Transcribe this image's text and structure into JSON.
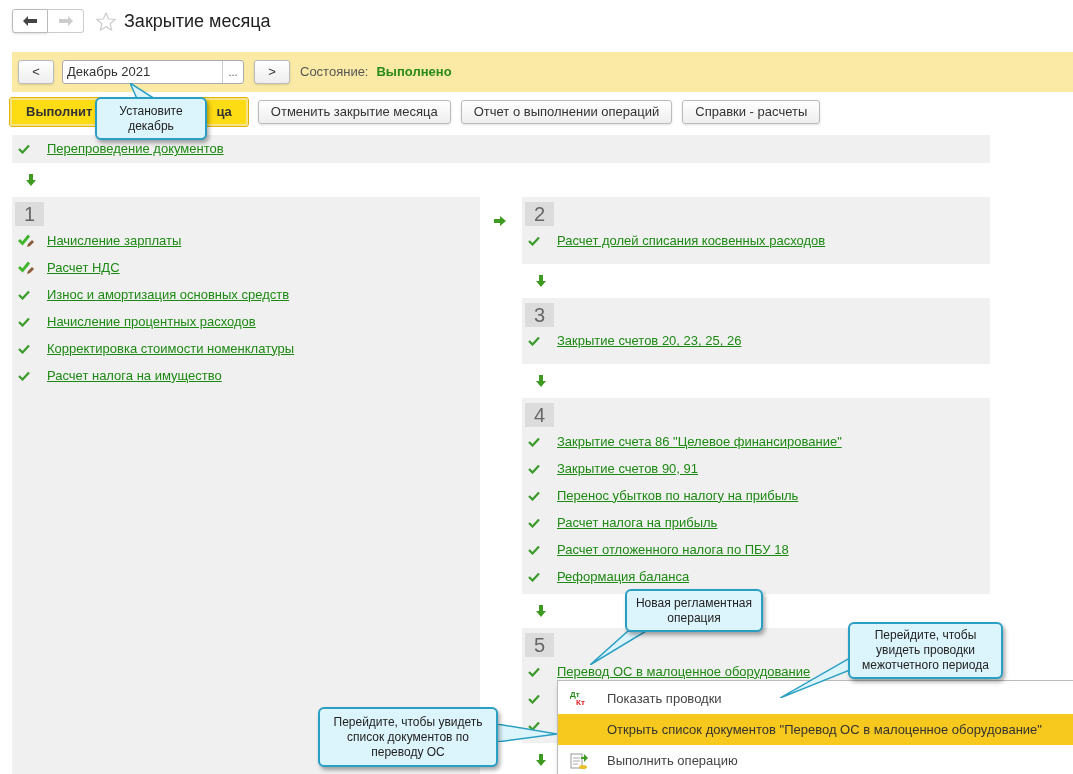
{
  "title": "Закрытие месяца",
  "period": {
    "prev": "<",
    "value": "Декабрь 2021",
    "pick": "...",
    "next": ">",
    "state_label": "Состояние:",
    "state_value": "Выполнено"
  },
  "buttons": [
    {
      "label_parts": [
        "Выполнит",
        "ца"
      ],
      "kind": "primary"
    },
    {
      "label": "Отменить закрытие месяца",
      "kind": "normal"
    },
    {
      "label": "Отчет о выполнении операций",
      "kind": "normal"
    },
    {
      "label": "Справки - расчеты",
      "kind": "normal"
    }
  ],
  "reposting": {
    "label": "Перепроведение документов",
    "kind": "check"
  },
  "left_column": [
    {
      "kind": "group",
      "number": "1",
      "items": [
        {
          "label": "Начисление зарплаты",
          "kind": "check_manual"
        },
        {
          "label": "Расчет НДС",
          "kind": "check_manual"
        },
        {
          "label": "Износ и амортизация основных средств",
          "kind": "check"
        },
        {
          "label": "Начисление процентных расходов",
          "kind": "check"
        },
        {
          "label": "Корректировка стоимости номенклатуры",
          "kind": "check"
        },
        {
          "label": "Расчет налога на имущество",
          "kind": "check"
        }
      ]
    }
  ],
  "right_column": [
    {
      "kind": "group",
      "number": "2",
      "items": [
        {
          "label": "Расчет долей списания косвенных расходов",
          "kind": "check"
        }
      ]
    },
    {
      "kind": "arrow"
    },
    {
      "kind": "group",
      "number": "3",
      "items": [
        {
          "label": "Закрытие счетов 20, 23, 25, 26",
          "kind": "check"
        }
      ]
    },
    {
      "kind": "arrow"
    },
    {
      "kind": "group",
      "number": "4",
      "items": [
        {
          "label": "Закрытие счета 86 \"Целевое финансирование\"",
          "kind": "check"
        },
        {
          "label": "Закрытие счетов 90, 91",
          "kind": "check"
        },
        {
          "label": "Перенос убытков по налогу на прибыль",
          "kind": "check"
        },
        {
          "label": "Расчет налога на прибыль",
          "kind": "check"
        },
        {
          "label": "Расчет отложенного налога по ПБУ 18",
          "kind": "check"
        },
        {
          "label": "Реформация баланса",
          "kind": "check"
        }
      ]
    },
    {
      "kind": "arrow"
    },
    {
      "kind": "group",
      "number": "5",
      "items": [
        {
          "label": "Перевод ОС в малоценное оборудование",
          "kind": "check"
        },
        {
          "kind": "check"
        },
        {
          "kind": "check"
        }
      ]
    },
    {
      "kind": "arrow"
    }
  ],
  "context_menu": [
    {
      "kind": "postings",
      "icon_top": "Дт",
      "icon_bottom": "Кт",
      "label": "Показать проводки",
      "selected": false
    },
    {
      "kind": "plain",
      "label": "Открыть список документов \"Перевод ОС в малоценное оборудование\"",
      "selected": true
    },
    {
      "kind": "execute",
      "label": "Выполнить операцию",
      "selected": false
    }
  ],
  "callouts": [
    "Установите декабрь",
    "Новая регламентная операция",
    "Перейдите, чтобы увидеть проводки межотчетного периода",
    "Перейдите, чтобы увидеть список документов по переводу ОС"
  ]
}
